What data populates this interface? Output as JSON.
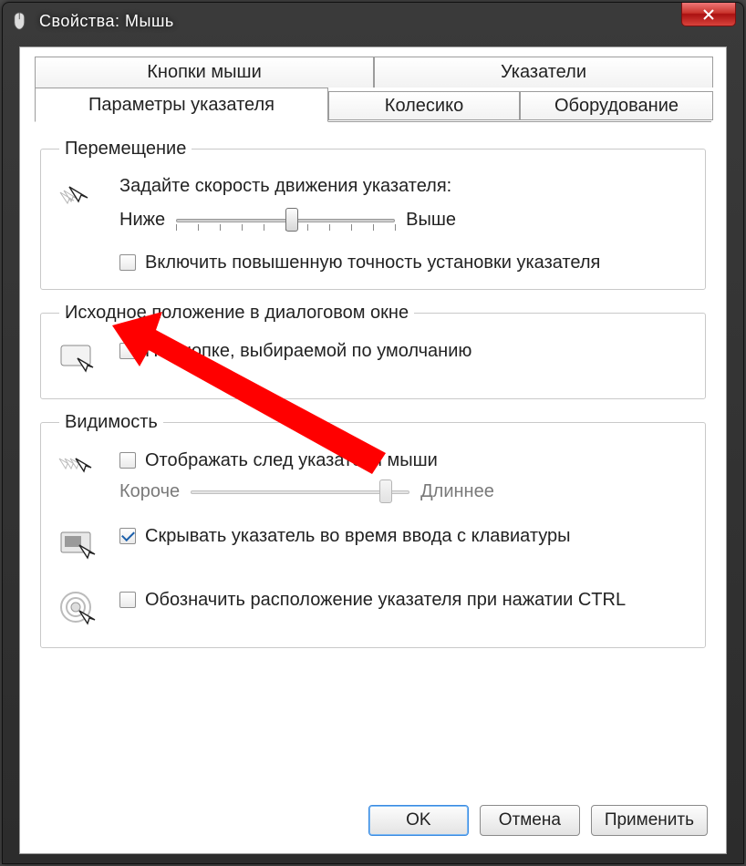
{
  "window": {
    "title": "Свойства: Мышь"
  },
  "tabs": {
    "buttons": "Кнопки мыши",
    "pointers": "Указатели",
    "pointer_options": "Параметры указателя",
    "wheel": "Колесико",
    "hardware": "Оборудование"
  },
  "groups": {
    "motion": {
      "title": "Перемещение",
      "speed_label": "Задайте скорость движения указателя:",
      "slow": "Ниже",
      "fast": "Выше",
      "enhance": "Включить повышенную точность установки указателя"
    },
    "snap": {
      "title": "Исходное положение в диалоговом окне",
      "snap_label": "На кнопке, выбираемой по умолчанию"
    },
    "visibility": {
      "title": "Видимость",
      "trails": "Отображать след указателя мыши",
      "trails_short": "Короче",
      "trails_long": "Длиннее",
      "hide_typing": "Скрывать указатель во время ввода с клавиатуры",
      "ctrl_locate": "Обозначить расположение указателя при нажатии CTRL"
    }
  },
  "buttons": {
    "ok": "OK",
    "cancel": "Отмена",
    "apply": "Применить"
  }
}
